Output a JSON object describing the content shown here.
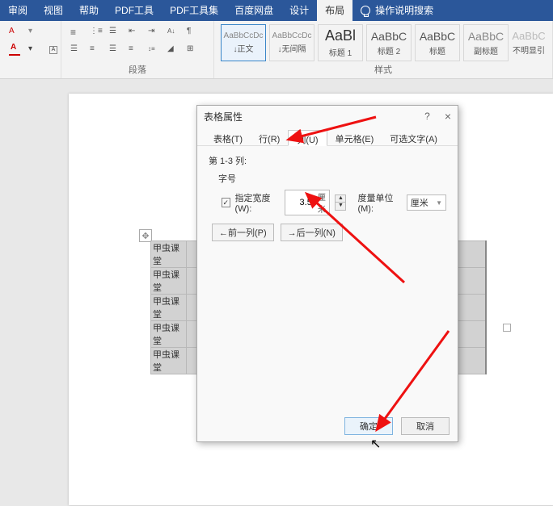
{
  "menubar": {
    "items": [
      "审阅",
      "视图",
      "帮助",
      "PDF工具",
      "PDF工具集",
      "百度网盘",
      "设计",
      "布局"
    ],
    "active_index": 7,
    "search_placeholder": "操作说明搜索"
  },
  "ribbon": {
    "paragraph_group_label": "段落",
    "styles_group_label": "样式",
    "styles": [
      {
        "sample": "AaBbCcDc",
        "label": "↓正文"
      },
      {
        "sample": "AaBbCcDc",
        "label": "↓无间隔"
      },
      {
        "sample": "AaBl",
        "label": "标题 1"
      },
      {
        "sample": "AaBbC",
        "label": "标题 2"
      },
      {
        "sample": "AaBbC",
        "label": "标题"
      },
      {
        "sample": "AaBbC",
        "label": "副标题"
      },
      {
        "sample": "AaBbC",
        "label": "不明显引"
      }
    ]
  },
  "table_cells": [
    "甲虫课堂",
    "甲虫课堂",
    "甲虫课堂",
    "甲虫课堂",
    "甲虫课堂"
  ],
  "dialog": {
    "title": "表格属性",
    "help": "?",
    "close": "×",
    "tabs": [
      "表格(T)",
      "行(R)",
      "列(U)",
      "单元格(E)",
      "可选文字(A)"
    ],
    "active_tab_index": 2,
    "col_range_label": "第 1-3 列:",
    "size_label": "字号",
    "specify_width_check": true,
    "specify_width_label": "指定宽度(W):",
    "width_value": "3.5",
    "width_unit_inline": "厘米",
    "measure_unit_label": "度量单位(M):",
    "measure_unit_value": "厘米",
    "prev_col_btn": "←前一列(P)",
    "next_col_btn": "→后一列(N)",
    "ok_btn": "确定",
    "cancel_btn": "取消"
  }
}
